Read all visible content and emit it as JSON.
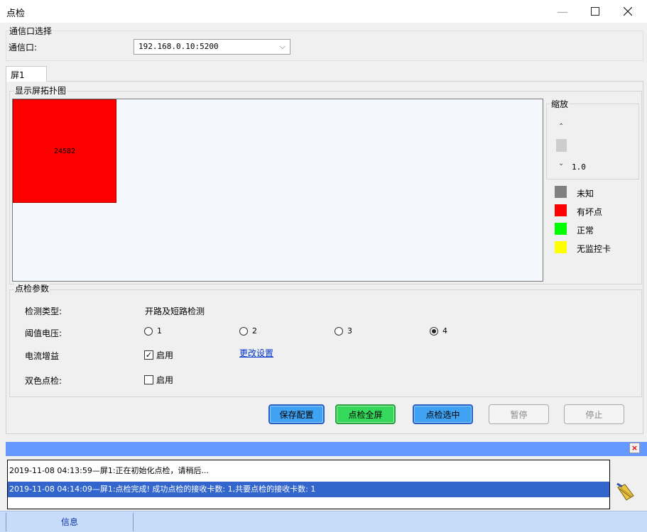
{
  "window": {
    "title": "点检"
  },
  "comm": {
    "group_title": "通信口选择",
    "label": "通信口:",
    "selected": "192.168.0.10:5200"
  },
  "tabs": [
    {
      "label": "屏1"
    }
  ],
  "topology": {
    "group_title": "显示屏拓扑图",
    "cells": [
      {
        "label": "24582",
        "status": "有坏点",
        "color": "#ff0000"
      }
    ]
  },
  "zoom": {
    "group_title": "缩放",
    "value": "1.0"
  },
  "legend": [
    {
      "label": "未知",
      "color": "#808080"
    },
    {
      "label": "有坏点",
      "color": "#ff0000"
    },
    {
      "label": "正常",
      "color": "#00ff00"
    },
    {
      "label": "无监控卡",
      "color": "#ffff00"
    }
  ],
  "params": {
    "group_title": "点检参数",
    "detect_type_label": "检测类型:",
    "detect_type_value": "开路及短路检测",
    "threshold_label": "阈值电压:",
    "threshold_options": [
      "1",
      "2",
      "3",
      "4"
    ],
    "threshold_selected": "4",
    "gain_label": "电流增益",
    "gain_checkbox_label": "启用",
    "gain_checked": true,
    "gain_link": "更改设置",
    "dual_label": "双色点检:",
    "dual_checkbox_label": "启用",
    "dual_checked": false
  },
  "buttons": {
    "save": "保存配置",
    "check_all": "点检全屏",
    "check_selected": "点检选中",
    "pause": "暂停",
    "stop": "停止"
  },
  "log": [
    {
      "text": "2019-11-08 04:13:59—屏1:正在初始化点检，请稍后...",
      "selected": false
    },
    {
      "text": "2019-11-08 04:14:09—屏1:点检完成! 成功点检的接收卡数: 1,共要点检的接收卡数: 1",
      "selected": true
    }
  ],
  "status": {
    "tab_label": "信息"
  }
}
